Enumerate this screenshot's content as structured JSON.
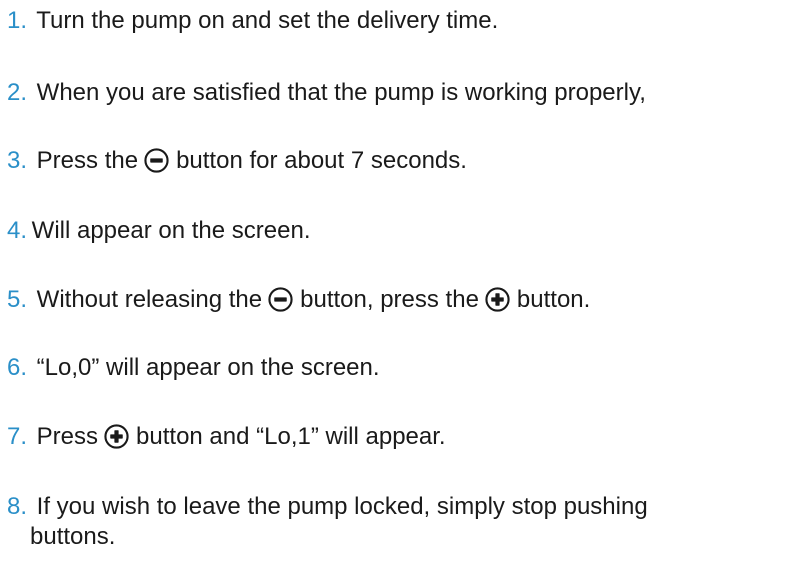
{
  "steps": [
    {
      "num": "1.",
      "text": "Turn the pump on and set the delivery time."
    },
    {
      "num": "2.",
      "text": "When you are satisfied that the pump is working properly,"
    },
    {
      "num": "3.",
      "pre": "Press the",
      "icon": "minus-circle-icon",
      "post": "button  for about 7 seconds."
    },
    {
      "num": "4.",
      "text": "Will appear on the screen."
    },
    {
      "num": "5.",
      "pre": "Without releasing the",
      "icon": "minus-circle-icon",
      "mid": "button,  press the",
      "icon2": "plus-circle-icon",
      "post": "button."
    },
    {
      "num": "6.",
      "text": "“Lo,0” will appear on the screen."
    },
    {
      "num": "7.",
      "pre": "Press",
      "icon": "plus-circle-icon",
      "post": "button and “Lo,1” will appear."
    },
    {
      "num": "8.",
      "text": "If you wish to leave the pump locked, simply stop pushing",
      "cont": "buttons."
    }
  ],
  "colors": {
    "number": "#2a8fc8",
    "text": "#1a1a1a"
  }
}
